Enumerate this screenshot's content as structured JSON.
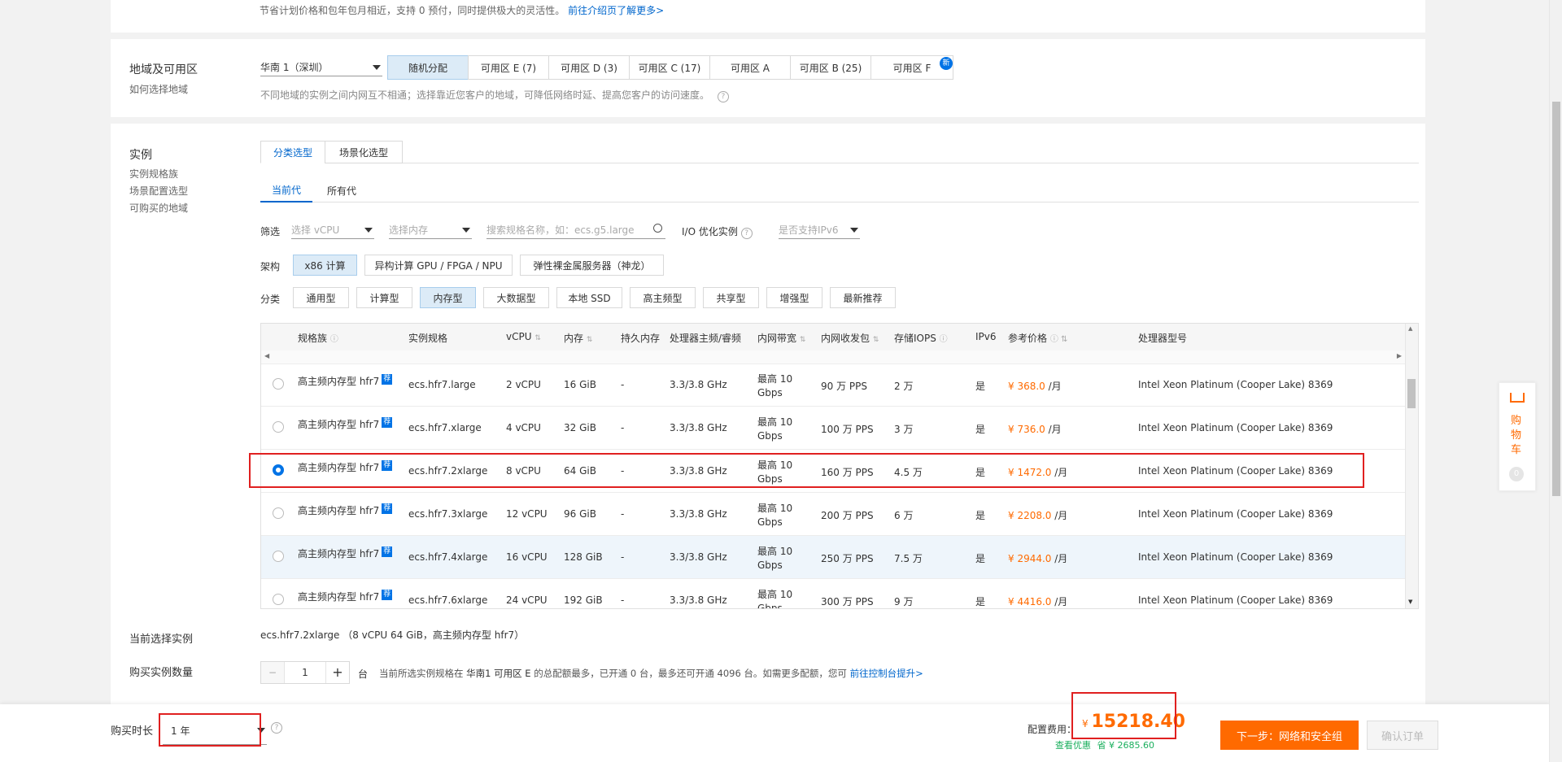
{
  "top_note": {
    "text": "节省计划价格和包年包月相近，支持 0 预付，同时提供极大的灵活性。",
    "link": "前往介绍页了解更多>"
  },
  "region": {
    "label": "地域及可用区",
    "sub_link": "如何选择地域",
    "selected": "华南 1（深圳）",
    "zones": [
      "随机分配",
      "可用区 E (7)",
      "可用区 D (3)",
      "可用区 C (17)",
      "可用区 A",
      "可用区 B (25)",
      "可用区 F"
    ],
    "new_badge": "新",
    "note": "不同地域的实例之间内网互不相通；选择靠近您客户的地域，可降低网络时延、提高您客户的访问速度。"
  },
  "instance": {
    "label": "实例",
    "sub_links": [
      "实例规格族",
      "场景配置选型",
      "可购买的地域"
    ],
    "tabs": [
      "分类选型",
      "场景化选型"
    ],
    "gen_tabs": [
      "当前代",
      "所有代"
    ],
    "filter_label": "筛选",
    "filter_vcpu": "选择 vCPU",
    "filter_mem": "选择内存",
    "search_placeholder": "搜索规格名称，如：ecs.g5.large",
    "io_label": "I/O 优化实例",
    "ipv6_placeholder": "是否支持IPv6",
    "arch_label": "架构",
    "arch": [
      "x86 计算",
      "异构计算 GPU / FPGA / NPU",
      "弹性裸金属服务器（神龙）"
    ],
    "category_label": "分类",
    "categories": [
      "通用型",
      "计算型",
      "内存型",
      "大数据型",
      "本地 SSD",
      "高主频型",
      "共享型",
      "增强型",
      "最新推荐"
    ]
  },
  "table": {
    "headers": [
      "规格族",
      "实例规格",
      "vCPU",
      "内存",
      "持久内存",
      "处理器主频/睿频",
      "内网带宽",
      "内网收发包",
      "存储IOPS",
      "IPv6",
      "参考价格",
      "处理器型号"
    ],
    "rows": [
      {
        "family": "高主频内存型 hfr7",
        "tag": "荐",
        "spec": "ecs.hfr7.large",
        "vcpu": "2 vCPU",
        "mem": "16 GiB",
        "pmem": "-",
        "freq": "3.3/3.8 GHz",
        "bw1": "最高 10",
        "bw2": "Gbps",
        "pps": "90 万 PPS",
        "iops": "2 万",
        "ipv6": "是",
        "price": "¥ 368.0",
        "unit": "/月",
        "cpu": "Intel Xeon Platinum (Cooper Lake) 8369"
      },
      {
        "family": "高主频内存型 hfr7",
        "tag": "荐",
        "spec": "ecs.hfr7.xlarge",
        "vcpu": "4 vCPU",
        "mem": "32 GiB",
        "pmem": "-",
        "freq": "3.3/3.8 GHz",
        "bw1": "最高 10",
        "bw2": "Gbps",
        "pps": "100 万 PPS",
        "iops": "3 万",
        "ipv6": "是",
        "price": "¥ 736.0",
        "unit": "/月",
        "cpu": "Intel Xeon Platinum (Cooper Lake) 8369"
      },
      {
        "family": "高主频内存型 hfr7",
        "tag": "荐",
        "spec": "ecs.hfr7.2xlarge",
        "vcpu": "8 vCPU",
        "mem": "64 GiB",
        "pmem": "-",
        "freq": "3.3/3.8 GHz",
        "bw1": "最高 10",
        "bw2": "Gbps",
        "pps": "160 万 PPS",
        "iops": "4.5 万",
        "ipv6": "是",
        "price": "¥ 1472.0",
        "unit": "/月",
        "cpu": "Intel Xeon Platinum (Cooper Lake) 8369"
      },
      {
        "family": "高主频内存型 hfr7",
        "tag": "荐",
        "spec": "ecs.hfr7.3xlarge",
        "vcpu": "12 vCPU",
        "mem": "96 GiB",
        "pmem": "-",
        "freq": "3.3/3.8 GHz",
        "bw1": "最高 10",
        "bw2": "Gbps",
        "pps": "200 万 PPS",
        "iops": "6 万",
        "ipv6": "是",
        "price": "¥ 2208.0",
        "unit": "/月",
        "cpu": "Intel Xeon Platinum (Cooper Lake) 8369"
      },
      {
        "family": "高主频内存型 hfr7",
        "tag": "荐",
        "spec": "ecs.hfr7.4xlarge",
        "vcpu": "16 vCPU",
        "mem": "128 GiB",
        "pmem": "-",
        "freq": "3.3/3.8 GHz",
        "bw1": "最高 10",
        "bw2": "Gbps",
        "pps": "250 万 PPS",
        "iops": "7.5 万",
        "ipv6": "是",
        "price": "¥ 2944.0",
        "unit": "/月",
        "cpu": "Intel Xeon Platinum (Cooper Lake) 8369"
      },
      {
        "family": "高主频内存型 hfr7",
        "tag": "荐",
        "spec": "ecs.hfr7.6xlarge",
        "vcpu": "24 vCPU",
        "mem": "192 GiB",
        "pmem": "-",
        "freq": "3.3/3.8 GHz",
        "bw1": "最高 10",
        "bw2": "Gbps",
        "pps": "300 万 PPS",
        "iops": "9 万",
        "ipv6": "是",
        "price": "¥ 4416.0",
        "unit": "/月",
        "cpu": "Intel Xeon Platinum (Cooper Lake) 8369"
      }
    ]
  },
  "current": {
    "label": "当前选择实例",
    "value": "ecs.hfr7.2xlarge （8 vCPU 64 GiB，高主频内存型 hfr7）"
  },
  "quantity": {
    "label": "购买实例数量",
    "minus": "−",
    "value": "1",
    "plus": "+",
    "unit": "台",
    "note_prefix": "当前所选实例规格在",
    "note_zone": "华南1 可用区 E",
    "note_suffix": "的总配额最多，已开通 0 台，最多还可开通 4096 台。如需更多配额，您可",
    "note_link": "前往控制台提升>"
  },
  "footer": {
    "duration_label": "购买时长",
    "duration_value": "1 年",
    "fee_label": "配置费用：",
    "currency": "¥",
    "price": "15218.40",
    "discount_link": "查看优惠",
    "save_label": "省 ¥ 2685.60",
    "next_button": "下一步：网络和安全组",
    "confirm_button": "确认订单"
  },
  "cart": {
    "label": "购物车",
    "count": "0"
  },
  "colors": {
    "accent": "#0066cc",
    "orange": "#ff6a00",
    "highlight": "#e02020"
  }
}
